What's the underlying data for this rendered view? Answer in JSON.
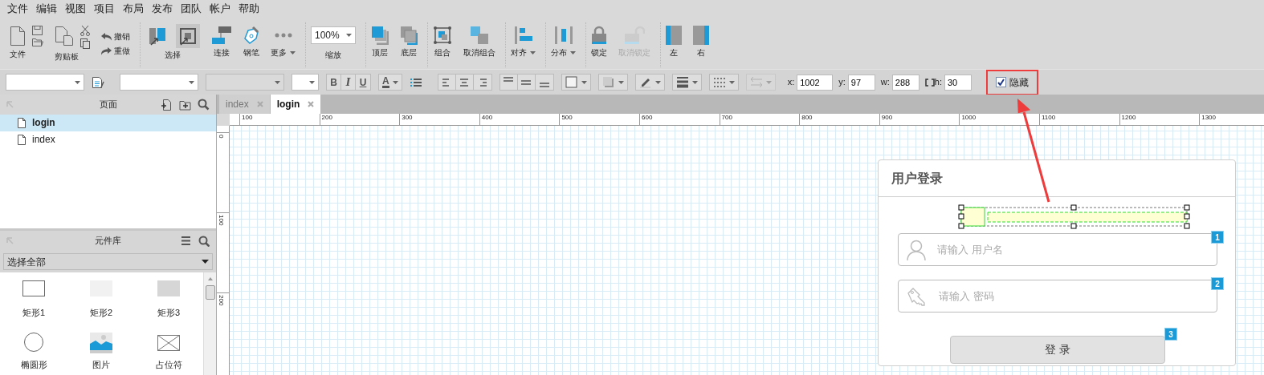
{
  "menu": [
    "文件",
    "编辑",
    "视图",
    "项目",
    "布局",
    "发布",
    "团队",
    "帐户",
    "帮助"
  ],
  "ribbon": {
    "groups": [
      [
        {
          "kind": "file",
          "label": "文件"
        },
        {
          "kind": "clipboard",
          "label": "剪贴板"
        },
        {
          "kind": "history",
          "items": [
            {
              "kind": "undo",
              "label": "撤销"
            },
            {
              "kind": "redo",
              "label": "重做"
            }
          ]
        }
      ],
      [
        {
          "kind": "select",
          "label": "选择",
          "modes": [
            {
              "kind": "intersect",
              "selected": false
            },
            {
              "kind": "contain",
              "selected": true
            }
          ]
        },
        {
          "kind": "connector",
          "label": "连接"
        },
        {
          "kind": "pen",
          "label": "钢笔"
        },
        {
          "kind": "more",
          "label": "更多",
          "dropdown": true
        }
      ],
      [
        {
          "kind": "zoom",
          "value": "100%",
          "label": "缩放"
        }
      ],
      [
        {
          "kind": "bring-front",
          "label": "顶层"
        },
        {
          "kind": "send-back",
          "label": "底层"
        }
      ],
      [
        {
          "kind": "group",
          "label": "组合"
        },
        {
          "kind": "ungroup",
          "label": "取消组合"
        }
      ],
      [
        {
          "kind": "align",
          "label": "对齐",
          "dropdown": true
        }
      ],
      [
        {
          "kind": "distribute",
          "label": "分布",
          "dropdown": true
        }
      ],
      [
        {
          "kind": "lock",
          "label": "锁定",
          "disabled": false
        },
        {
          "kind": "unlock",
          "label": "取消锁定",
          "disabled": true
        }
      ],
      [
        {
          "kind": "dock-left",
          "label": "左"
        },
        {
          "kind": "dock-right",
          "label": "右"
        }
      ]
    ]
  },
  "format_bar": {
    "items": [
      {
        "kind": "select-wide",
        "disabled": false
      },
      {
        "kind": "style-edit"
      },
      {
        "kind": "select-wide",
        "disabled": false
      },
      {
        "kind": "select-wide",
        "disabled": true
      },
      {
        "kind": "select-narrow",
        "disabled": false
      },
      {
        "kind": "button-group",
        "buttons": [
          {
            "kind": "bold",
            "label": "B"
          },
          {
            "kind": "italic",
            "label": "I"
          },
          {
            "kind": "underline",
            "label": "U"
          }
        ]
      },
      {
        "kind": "font-color",
        "label": "A",
        "disabled": false
      },
      {
        "kind": "bullets"
      },
      {
        "kind": "button-group",
        "buttons": [
          {
            "kind": "align-left"
          },
          {
            "kind": "align-center"
          },
          {
            "kind": "align-right"
          }
        ]
      },
      {
        "kind": "button-group",
        "buttons": [
          {
            "kind": "valign-top"
          },
          {
            "kind": "valign-middle"
          },
          {
            "kind": "valign-bottom"
          }
        ]
      },
      {
        "kind": "fill",
        "disabled": false
      },
      {
        "kind": "shadow",
        "disabled": false
      },
      {
        "kind": "line-color",
        "disabled": false
      },
      {
        "kind": "line-width",
        "disabled": false
      },
      {
        "kind": "line-style",
        "disabled": false
      },
      {
        "kind": "arrow-style",
        "disabled": true
      }
    ],
    "position": [
      {
        "kind": "plain",
        "label": "x:",
        "value": "1002"
      },
      {
        "kind": "plain",
        "label": "y:",
        "value": "97"
      },
      {
        "kind": "plain",
        "label": "w:",
        "value": "288"
      },
      {
        "kind": "ratio",
        "label": "h:",
        "value": "30"
      }
    ],
    "hidden": {
      "label": "隐藏",
      "checked": true,
      "highlighted": true
    }
  },
  "pages_panel": {
    "title": "页面",
    "pages": [
      {
        "name": "login",
        "selected": true
      },
      {
        "name": "index",
        "selected": false
      }
    ]
  },
  "library_panel": {
    "title": "元件库",
    "filter": "选择全部",
    "items": [
      {
        "kind": "rect-outline",
        "label": "矩形1"
      },
      {
        "kind": "rect-light",
        "label": "矩形2"
      },
      {
        "kind": "rect-gray",
        "label": "矩形3"
      },
      {
        "kind": "ellipse",
        "label": "椭圆形"
      },
      {
        "kind": "image",
        "label": "图片"
      },
      {
        "kind": "placeholder",
        "label": "占位符"
      }
    ]
  },
  "tabs": [
    {
      "label": "index",
      "selected": false
    },
    {
      "label": "login",
      "selected": true
    }
  ],
  "ruler": {
    "horizontal": [
      "100",
      "200",
      "300",
      "400",
      "500",
      "600",
      "700",
      "800",
      "900",
      "1000",
      "1100",
      "1200",
      "1300"
    ],
    "vertical": [
      "0",
      "100",
      "200"
    ]
  },
  "widget": {
    "title": "用户登录",
    "hidden_element": {
      "selected": true
    },
    "fields": [
      {
        "kind": "user",
        "placeholder": "请输入 用户名",
        "badge": "1"
      },
      {
        "kind": "key",
        "placeholder": "请输入 密码",
        "badge": "2"
      }
    ],
    "button": {
      "label": "登 录",
      "badge": "3"
    }
  }
}
